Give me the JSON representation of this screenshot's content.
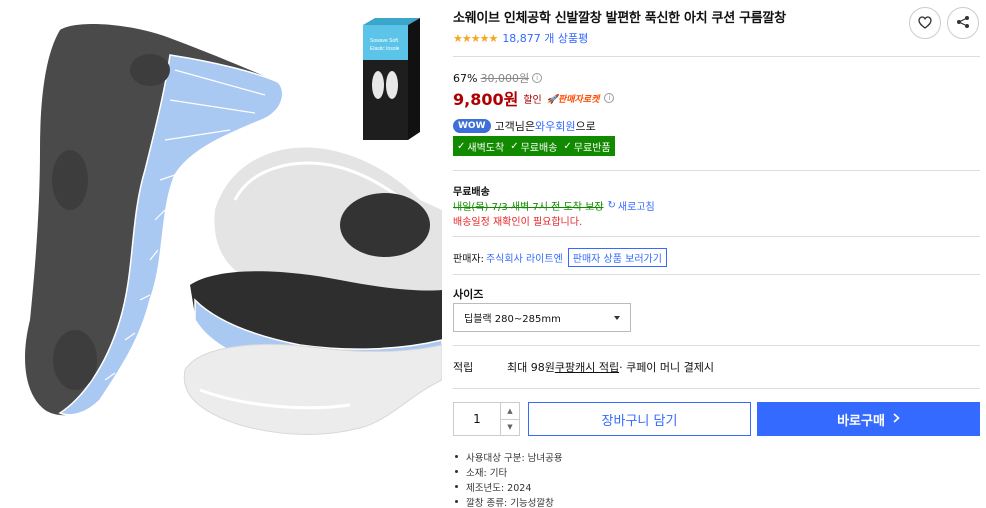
{
  "product": {
    "title": "소웨이브 인체공학 신발깔창 발편한 푹신한 아치 쿠션 구름깔창",
    "rating_stars": "★★★★★",
    "review_count": "18,877 개 상품평"
  },
  "pricing": {
    "discount_rate": "67%",
    "original_price": "30,000원",
    "sale_price": "9,800원",
    "sale_tag": "할인",
    "seller_rocket": "판매자로켓"
  },
  "membership": {
    "badge": "WOW",
    "prefix": "고객님은 ",
    "link": "와우회원",
    "suffix": "으로"
  },
  "benefits": [
    "새벽도착",
    "무료배송",
    "무료반품"
  ],
  "shipping": {
    "title": "무료배송",
    "date": "내일(목) 7/3 새벽 7시 전 도착 보장",
    "refresh": "새로고침",
    "warning": "배송일정 재확인이 필요합니다."
  },
  "seller": {
    "label": "판매자: ",
    "name": "주식회사 라이트엔",
    "more_button": "판매자 상품 보러가기"
  },
  "size": {
    "label": "사이즈",
    "selected": "딥블랙 280~285mm"
  },
  "reward": {
    "label": "적립",
    "prefix": "최대 98원 ",
    "link": "쿠팡캐시 적립",
    "suffix": " · 쿠페이 머니 결제시"
  },
  "purchase": {
    "quantity": "1",
    "cart_button": "장바구니 담기",
    "buy_button": "바로구매"
  },
  "specs": [
    "사용대상 구분: 남녀공용",
    "소재: 기타",
    "제조년도: 2024",
    "깔창 종류: 기능성깔창"
  ],
  "package": {
    "line1": "Sowave Soft",
    "line2": "Elastic Insole"
  },
  "colors": {
    "accent": "#346aff",
    "price_red": "#ae0000",
    "rocket_green": "#118a00",
    "warning_red": "#e52528",
    "star": "#f5a623"
  },
  "icons": {
    "favorite": "heart-icon",
    "share": "share-icon",
    "info": "info-icon",
    "check": "check-icon",
    "refresh": "refresh-icon",
    "dropdown": "caret-down-icon",
    "buy": "chevron-right-icon"
  }
}
